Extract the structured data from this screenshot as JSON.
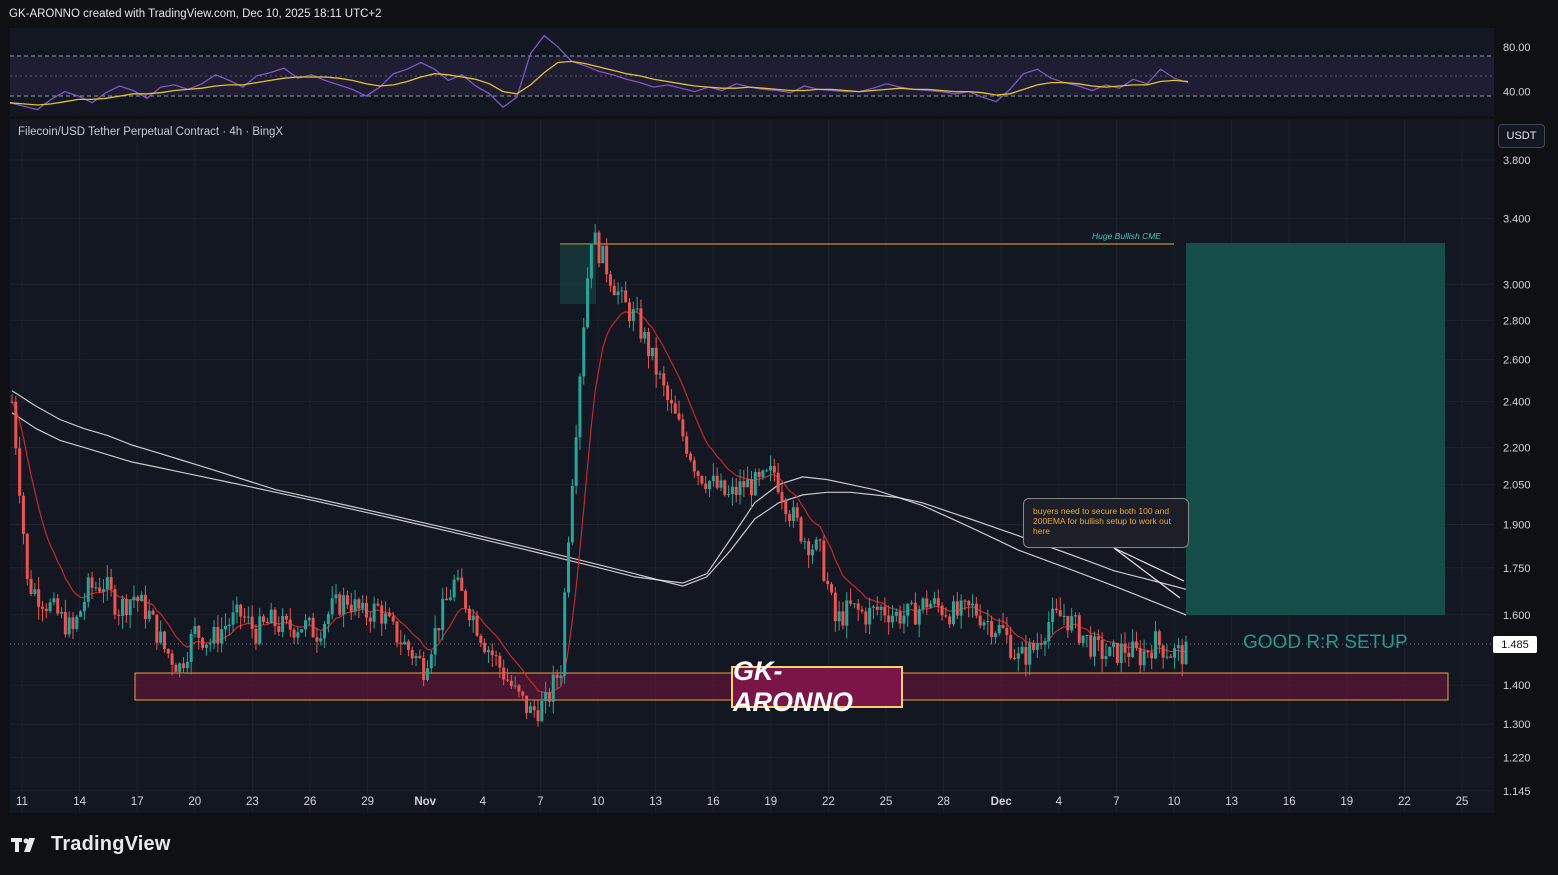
{
  "attribution": "GK-ARONNO created with TradingView.com, Dec 10, 2025 18:11 UTC+2",
  "symbol_title": "Filecoin/USD Tether Perpetual Contract · 4h · BingX",
  "currency_badge": "USDT",
  "current_price_label": "1.485",
  "watermark_text": "GK-ARONNO",
  "brand": "TradingView",
  "annotations": {
    "cme_label": "Huge Bullish CME",
    "note": "buyers need to secure both 100 and 200EMA for bullish setup to work out here",
    "rr_label": "GOOD R:R SETUP"
  },
  "colors": {
    "background": "#131722",
    "candle_up": "#26a69a",
    "candle_down": "#ef5350",
    "ema_fast": "#c62828",
    "ema_green": "#4caf50",
    "ma_white": "#e8e8e8",
    "rsi_line": "#7e57c2",
    "rsi_ma": "#e0c32f",
    "accent_gold": "#f3d26a",
    "zone_fill": "#5a1535",
    "target_fill": "#16574f"
  },
  "chart_data": [
    {
      "type": "line",
      "pane": "RSI",
      "y_ticks": [
        "80.00",
        "40.00"
      ],
      "ylim": [
        20,
        95
      ],
      "levels": [
        70,
        50,
        30
      ],
      "series": [
        {
          "values": [
            30,
            27,
            24,
            33,
            40,
            36,
            30,
            39,
            45,
            41,
            34,
            44,
            46,
            42,
            47,
            55,
            50,
            44,
            54,
            57,
            61,
            52,
            55,
            50,
            46,
            42,
            36,
            44,
            56,
            60,
            66,
            60,
            50,
            55,
            45,
            38,
            26,
            35,
            74,
            90,
            80,
            67,
            63,
            58,
            55,
            51,
            48,
            44,
            46,
            43,
            40,
            44,
            41,
            47,
            44,
            42,
            41,
            39,
            45,
            42,
            41,
            40,
            40,
            43,
            47,
            44,
            42,
            41,
            40,
            38,
            40,
            35,
            31,
            42,
            56,
            60,
            52,
            48,
            45,
            41,
            46,
            43,
            51,
            47,
            60,
            52,
            48
          ]
        },
        {
          "values": [
            30,
            29,
            28,
            29,
            31,
            33,
            33,
            34,
            36,
            38,
            38,
            39,
            41,
            42,
            43,
            45,
            46,
            46,
            48,
            50,
            52,
            53,
            53,
            53,
            52,
            50,
            47,
            45,
            46,
            49,
            53,
            56,
            55,
            53,
            51,
            47,
            40,
            38,
            46,
            57,
            66,
            67,
            65,
            62,
            59,
            56,
            54,
            51,
            49,
            47,
            45,
            44,
            43,
            43,
            44,
            43,
            42,
            41,
            41,
            42,
            42,
            41,
            40,
            41,
            42,
            43,
            42,
            42,
            41,
            40,
            40,
            39,
            37,
            38,
            42,
            46,
            48,
            48,
            47,
            45,
            44,
            45,
            46,
            46,
            49,
            50,
            49
          ]
        }
      ]
    },
    {
      "type": "line",
      "pane": "price",
      "x_tick_labels": [
        "11",
        "14",
        "17",
        "20",
        "23",
        "26",
        "29",
        "Nov",
        "4",
        "7",
        "10",
        "13",
        "16",
        "19",
        "22",
        "25",
        "28",
        "Dec",
        "4",
        "7",
        "10",
        "13",
        "16",
        "19",
        "22",
        "25"
      ],
      "y_tick_labels": [
        "3.800",
        "3.400",
        "3.000",
        "2.800",
        "2.600",
        "2.400",
        "2.200",
        "2.050",
        "1.900",
        "1.750",
        "1.600",
        "1.400",
        "1.300",
        "1.220",
        "1.145"
      ],
      "y_scale": "log",
      "ylim": [
        1.1,
        4.1
      ],
      "current_price": 1.485,
      "series": [
        {
          "values": [
            2.4,
            1.7,
            1.65,
            1.6,
            1.55,
            1.68,
            1.7,
            1.62,
            1.66,
            1.6,
            1.5,
            1.45,
            1.55,
            1.52,
            1.57,
            1.6,
            1.55,
            1.58,
            1.56,
            1.57,
            1.55,
            1.62,
            1.65,
            1.6,
            1.62,
            1.55,
            1.5,
            1.45,
            1.58,
            1.7,
            1.62,
            1.52,
            1.45,
            1.38,
            1.33,
            1.35,
            1.45,
            2.3,
            3.3,
            3.1,
            2.9,
            2.8,
            2.6,
            2.4,
            2.25,
            2.1,
            2.05,
            2.0,
            2.05,
            2.05,
            2.1,
            1.95,
            1.85,
            1.8,
            1.58,
            1.62,
            1.6,
            1.62,
            1.6,
            1.6,
            1.64,
            1.62,
            1.6,
            1.62,
            1.58,
            1.55,
            1.47,
            1.5,
            1.58,
            1.6,
            1.55,
            1.5,
            1.48,
            1.5,
            1.48,
            1.52,
            1.49,
            1.485
          ]
        },
        {
          "values": [
            2.45,
            2.38,
            2.32,
            2.28,
            2.25,
            2.21,
            2.18,
            2.15,
            2.12,
            2.09,
            2.06,
            2.03,
            2.01,
            1.99,
            1.97,
            1.95,
            1.93,
            1.91,
            1.89,
            1.87,
            1.85,
            1.83,
            1.81,
            1.79,
            1.77,
            1.75,
            1.73,
            1.71,
            1.69,
            1.72,
            1.81,
            1.92,
            1.98,
            2.01,
            2.02,
            2.02,
            2.01,
            2.0,
            1.98,
            1.95,
            1.92,
            1.89,
            1.86,
            1.83,
            1.8,
            1.77,
            1.74,
            1.72,
            1.7,
            1.68
          ]
        },
        {
          "values": [
            2.35,
            2.28,
            2.23,
            2.2,
            2.17,
            2.14,
            2.12,
            2.1,
            2.08,
            2.06,
            2.04,
            2.02,
            2.0,
            1.98,
            1.96,
            1.94,
            1.92,
            1.9,
            1.88,
            1.86,
            1.84,
            1.82,
            1.8,
            1.78,
            1.76,
            1.74,
            1.72,
            1.71,
            1.7,
            1.73,
            1.85,
            1.98,
            2.05,
            2.08,
            2.07,
            2.05,
            2.03,
            2.0,
            1.97,
            1.93,
            1.89,
            1.85,
            1.81,
            1.78,
            1.75,
            1.72,
            1.69,
            1.66,
            1.63,
            1.6
          ]
        }
      ]
    }
  ]
}
